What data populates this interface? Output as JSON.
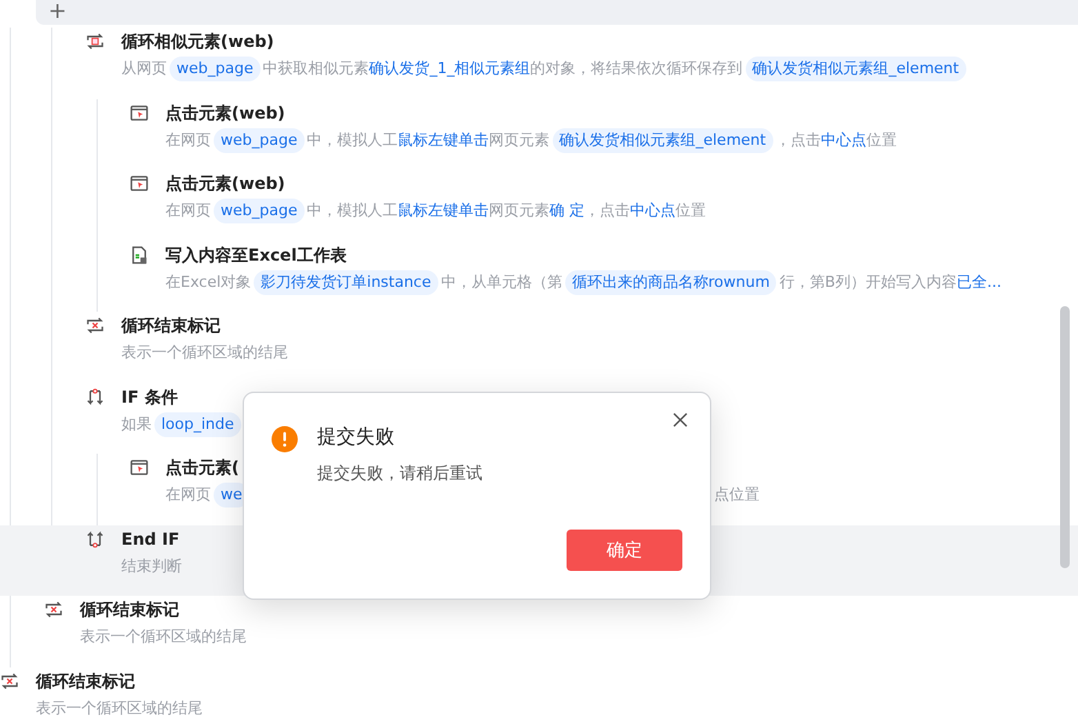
{
  "toolbar": {
    "add_label": "+"
  },
  "steps": [
    {
      "kind": "block",
      "selected": false,
      "children": [
        {
          "kind": "block",
          "selected": false,
          "children": [
            {
              "kind": "loop",
              "selected": false,
              "title": "循环相似元素(web)",
              "desc": [
                {
                  "kind": "text",
                  "text": "从网页"
                },
                {
                  "kind": "chip",
                  "text": "web_page"
                },
                {
                  "kind": "text",
                  "text": "中获取相似元素"
                },
                {
                  "kind": "link",
                  "text": "确认发货_1_相似元素组"
                },
                {
                  "kind": "text",
                  "text": "的对象，将结果依次循环保存到"
                },
                {
                  "kind": "chip",
                  "text": "确认发货相似元素组_element"
                }
              ],
              "children": [
                {
                  "kind": "click",
                  "selected": false,
                  "title": "点击元素(web)",
                  "desc": [
                    {
                      "kind": "text",
                      "text": "在网页"
                    },
                    {
                      "kind": "chip",
                      "text": "web_page"
                    },
                    {
                      "kind": "text",
                      "text": "中，模拟人工"
                    },
                    {
                      "kind": "link",
                      "text": "鼠标左键单击"
                    },
                    {
                      "kind": "text",
                      "text": "网页元素"
                    },
                    {
                      "kind": "chip",
                      "text": "确认发货相似元素组_element"
                    },
                    {
                      "kind": "text",
                      "text": "，点击"
                    },
                    {
                      "kind": "link",
                      "text": "中心点"
                    },
                    {
                      "kind": "text",
                      "text": "位置"
                    }
                  ]
                },
                {
                  "kind": "click",
                  "selected": false,
                  "title": "点击元素(web)",
                  "desc": [
                    {
                      "kind": "text",
                      "text": "在网页"
                    },
                    {
                      "kind": "chip",
                      "text": "web_page"
                    },
                    {
                      "kind": "text",
                      "text": "中，模拟人工"
                    },
                    {
                      "kind": "link",
                      "text": "鼠标左键单击"
                    },
                    {
                      "kind": "text",
                      "text": "网页元素"
                    },
                    {
                      "kind": "link",
                      "text": "确 定"
                    },
                    {
                      "kind": "text",
                      "text": "，点击"
                    },
                    {
                      "kind": "link",
                      "text": "中心点"
                    },
                    {
                      "kind": "text",
                      "text": "位置"
                    }
                  ]
                },
                {
                  "kind": "excel",
                  "selected": false,
                  "title": "写入内容至Excel工作表",
                  "desc": [
                    {
                      "kind": "text",
                      "text": "在Excel对象"
                    },
                    {
                      "kind": "chip",
                      "text": "影刀待发货订单instance"
                    },
                    {
                      "kind": "text",
                      "text": "中，从单元格（第"
                    },
                    {
                      "kind": "chip",
                      "text": "循环出来的商品名称rownum"
                    },
                    {
                      "kind": "text",
                      "text": "行，第B列）开始写入内容"
                    },
                    {
                      "kind": "link",
                      "text": "已全..."
                    }
                  ]
                }
              ]
            },
            {
              "kind": "loop_end",
              "selected": false,
              "title": "循环结束标记",
              "desc": [
                {
                  "kind": "text",
                  "text": "表示一个循环区域的结尾"
                }
              ]
            },
            {
              "kind": "if",
              "selected": false,
              "title": "IF 条件",
              "desc": [
                {
                  "kind": "text",
                  "text": "如果"
                },
                {
                  "kind": "chip",
                  "text": "loop_inde"
                }
              ],
              "children": [
                {
                  "kind": "click",
                  "selected": false,
                  "title": "点击元素(",
                  "desc": [
                    {
                      "kind": "text",
                      "text": "在网页"
                    },
                    {
                      "kind": "chip",
                      "text": "we"
                    },
                    {
                      "kind": "tail",
                      "text": "点位置"
                    }
                  ]
                }
              ]
            },
            {
              "kind": "end_if",
              "selected": true,
              "title": "End IF",
              "desc": [
                {
                  "kind": "text",
                  "text": "结束判断"
                }
              ]
            }
          ]
        },
        {
          "kind": "loop_end",
          "selected": false,
          "title": "循环结束标记",
          "desc": [
            {
              "kind": "text",
              "text": "表示一个循环区域的结尾"
            }
          ]
        }
      ]
    },
    {
      "kind": "loop_end",
      "selected": false,
      "title": "循环结束标记",
      "desc": [
        {
          "kind": "text",
          "text": "表示一个循环区域的结尾"
        }
      ]
    }
  ],
  "dialog": {
    "title": "提交失败",
    "message": "提交失败，请稍后重试",
    "confirm": "确定"
  }
}
